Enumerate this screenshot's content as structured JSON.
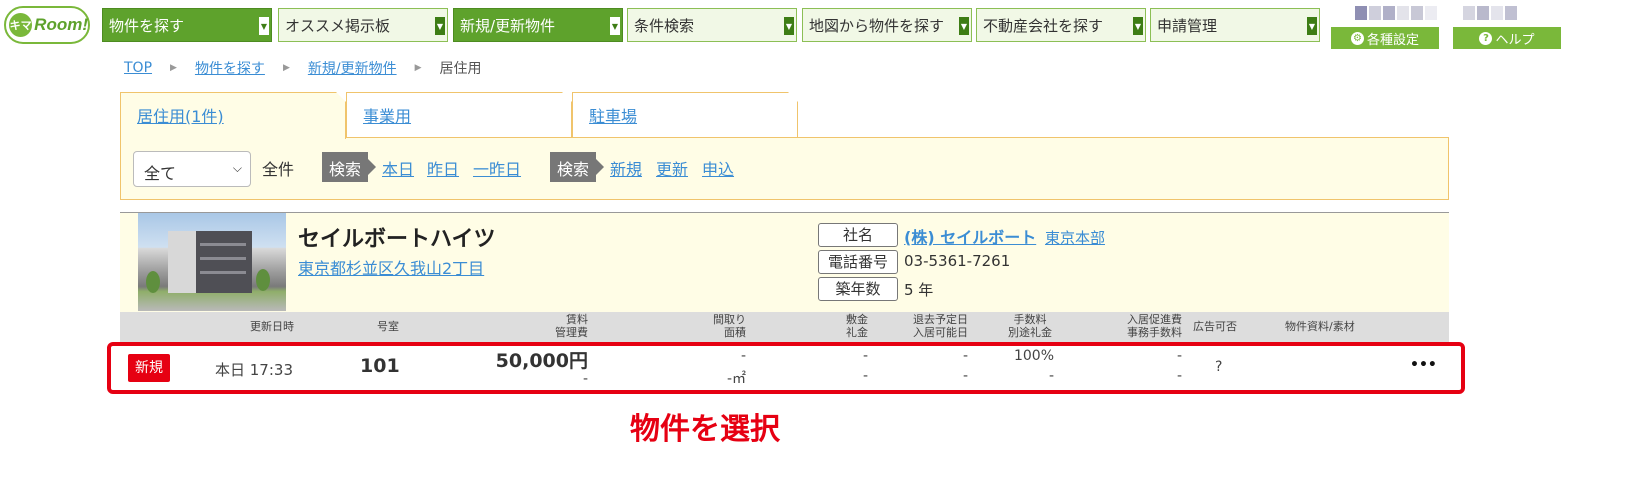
{
  "logo": {
    "badge": "キマ",
    "text": "Room!"
  },
  "nav": {
    "menus": [
      "物件を探す",
      "オススメ掲示板",
      "新規/更新物件",
      "条件検索",
      "地図から物件を探す",
      "不動産会社を探す",
      "申請管理"
    ],
    "settings_label": "各種設定",
    "help_label": "ヘルプ"
  },
  "breadcrumb": [
    "TOP",
    "物件を探す",
    "新規/更新物件",
    "居住用"
  ],
  "tabs": [
    "居住用(1件)",
    "事業用",
    "駐車場"
  ],
  "filter": {
    "select_value": "全て",
    "count_label": "全件",
    "search_label": "検索",
    "date_links": [
      "本日",
      "昨日",
      "一昨日"
    ],
    "status_links": [
      "新規",
      "更新",
      "申込"
    ]
  },
  "property": {
    "name": "セイルボートハイツ",
    "address": "東京都杉並区久我山2丁目",
    "labels": {
      "company": "社名",
      "phone": "電話番号",
      "age": "築年数"
    },
    "company_name": "(株) セイルボート",
    "company_branch": "東京本部",
    "phone": "03-5361-7261",
    "age": "5 年"
  },
  "table": {
    "headers": {
      "updated": "更新日時",
      "room": "号室",
      "rent": "賃料",
      "mgmt": "管理費",
      "layout": "間取り",
      "area": "面積",
      "deposit": "敷金",
      "key_money": "礼金",
      "leave": "退去予定日",
      "move_in": "入居可能日",
      "fee": "手数料",
      "extra_key": "別途礼金",
      "promo": "入居促進費",
      "admin_fee": "事務手数料",
      "ad": "広告可否",
      "docs": "物件資料/素材"
    },
    "row": {
      "badge": "新規",
      "updated": "本日 17:33",
      "room": "101",
      "rent": "50,000円",
      "mgmt": "-",
      "layout": "-",
      "area": "-㎡",
      "deposit": "-",
      "key_money": "-",
      "leave": "-",
      "move_in": "-",
      "fee": "100%",
      "extra_key": "-",
      "promo": "-",
      "admin_fee": "-",
      "ad": "?",
      "more": "•••"
    }
  },
  "annotation": "物件を選択",
  "colors": {
    "brand_green": "#7ab83a",
    "accent_red": "#e60012",
    "link_blue": "#3b8dd4",
    "panel_yellow": "#fffde6"
  }
}
